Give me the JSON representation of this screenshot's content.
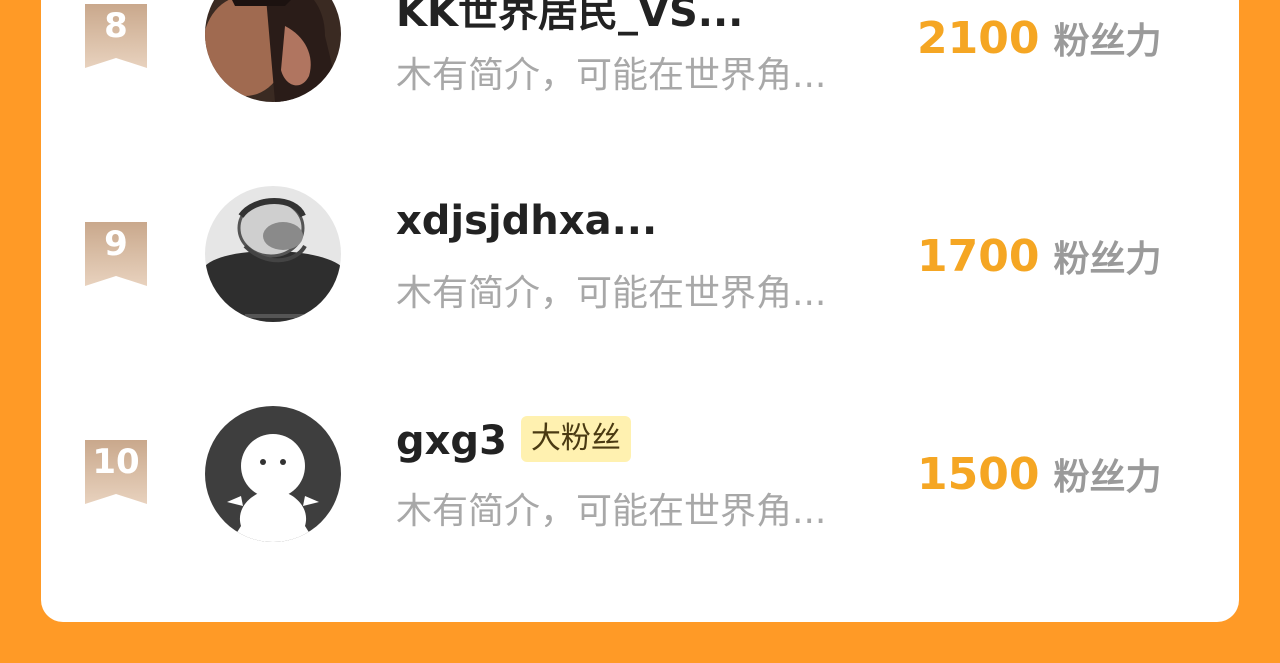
{
  "list": {
    "items": [
      {
        "rank": "8",
        "name": "KK世界居民_VS...",
        "intro": "木有简介，可能在世界角...",
        "score": "2100",
        "score_unit": "粉丝力",
        "badge": ""
      },
      {
        "rank": "9",
        "name": "xdjsjdhxa...",
        "intro": "木有简介，可能在世界角...",
        "score": "1700",
        "score_unit": "粉丝力",
        "badge": ""
      },
      {
        "rank": "10",
        "name": "gxg3",
        "intro": "木有简介，可能在世界角...",
        "score": "1500",
        "score_unit": "粉丝力",
        "badge": "大粉丝"
      }
    ]
  },
  "colors": {
    "background": "#FF9A26",
    "score": "#F5A623",
    "rank_badge": "#D9B89C",
    "fan_tag_bg": "#FFF1B0"
  },
  "icons": [
    "rank-ribbon-icon",
    "user-avatar",
    "default-avatar-icon"
  ]
}
